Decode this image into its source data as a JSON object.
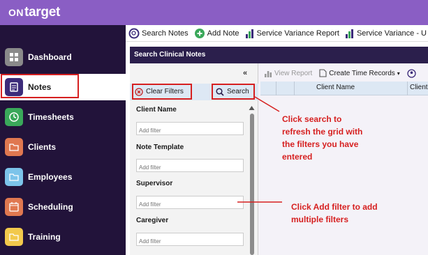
{
  "app": {
    "logo_prefix": "ON",
    "logo_main": "target"
  },
  "sidebar": {
    "items": [
      {
        "label": "Dashboard",
        "icon": "dashboard-icon",
        "color": "#8a8a8a"
      },
      {
        "label": "Notes",
        "icon": "notes-icon",
        "color": "#3c2b7a",
        "active": true
      },
      {
        "label": "Timesheets",
        "icon": "clock-icon",
        "color": "#3aa85a"
      },
      {
        "label": "Clients",
        "icon": "folder-icon",
        "color": "#e07850"
      },
      {
        "label": "Employees",
        "icon": "folder-icon",
        "color": "#7cc4ea"
      },
      {
        "label": "Scheduling",
        "icon": "calendar-icon",
        "color": "#e07850"
      },
      {
        "label": "Training",
        "icon": "folder-icon",
        "color": "#f2c94c"
      }
    ]
  },
  "toolbar": {
    "search_notes": "Search Notes",
    "add_note": "Add Note",
    "service_variance_report": "Service Variance Report",
    "service_variance_u": "Service Variance - U"
  },
  "panel": {
    "title": "Search Clinical Notes",
    "collapse": "«",
    "clear_filters": "Clear Filters",
    "search": "Search",
    "filters": [
      {
        "label": "Client Name",
        "placeholder": "Add filter"
      },
      {
        "label": "Note Template",
        "placeholder": "Add filter"
      },
      {
        "label": "Supervisor",
        "placeholder": "Add filter"
      },
      {
        "label": "Caregiver",
        "placeholder": "Add filter"
      }
    ]
  },
  "grid": {
    "view_report": "View Report",
    "create_time_records": "Create Time Records",
    "columns": [
      "Client Name",
      "Client"
    ]
  },
  "annotations": {
    "search_note": [
      "Click search to",
      "refresh the grid with",
      "the filters you have",
      "entered"
    ],
    "add_filter_note": [
      "Click Add filter to add",
      "multiple filters"
    ]
  },
  "colors": {
    "header": "#8a5ec4",
    "sidebar": "#22133a",
    "panel_title": "#2b1f4c",
    "annotation": "#d62020"
  }
}
